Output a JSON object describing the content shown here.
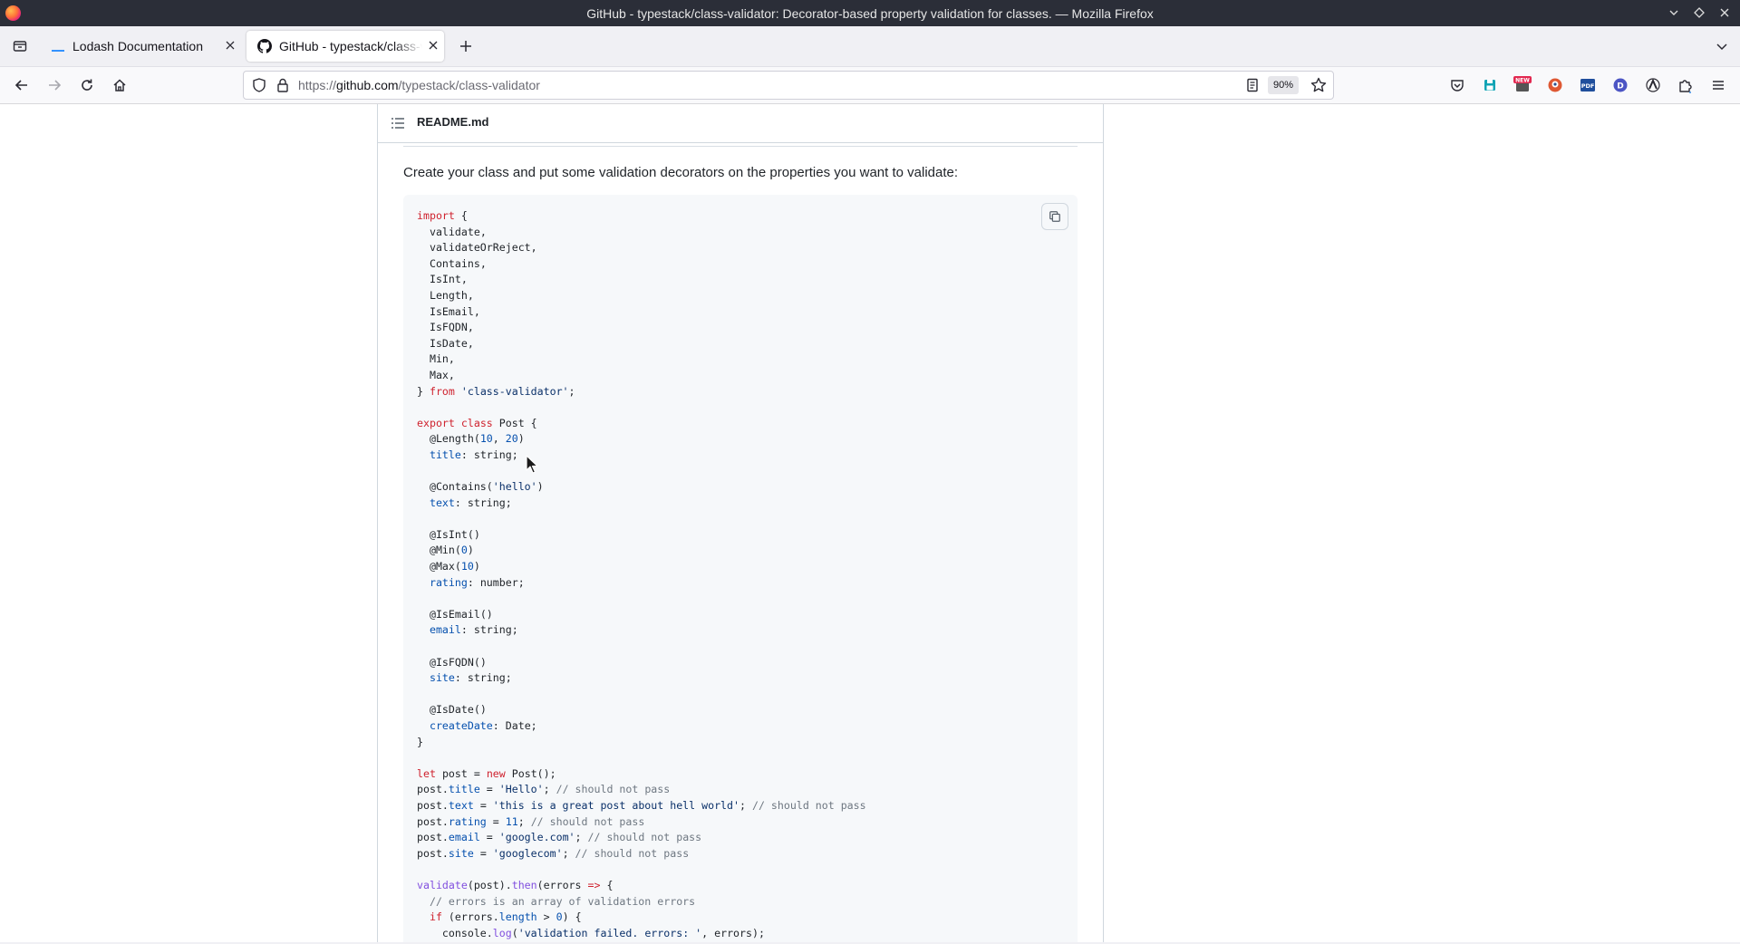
{
  "window": {
    "title": "GitHub - typestack/class-validator: Decorator-based property validation for classes. — Mozilla Firefox"
  },
  "tabs": [
    {
      "label": "Lodash Documentation",
      "active": false,
      "favicon": "lodash-favicon"
    },
    {
      "label": "GitHub - typestack/class-validator: Decorator-based property validation for classes.",
      "active": true,
      "favicon": "github-favicon"
    }
  ],
  "navbar": {
    "url_scheme": "https://",
    "url_host": "github.com",
    "url_path": "/typestack/class-validator",
    "zoom": "90%"
  },
  "readme": {
    "filename": "README.md",
    "intro": "Create your class and put some validation decorators on the properties you want to validate:"
  },
  "code_lines": [
    "import {",
    "  validate,",
    "  validateOrReject,",
    "  Contains,",
    "  IsInt,",
    "  Length,",
    "  IsEmail,",
    "  IsFQDN,",
    "  IsDate,",
    "  Min,",
    "  Max,",
    "} from 'class-validator';",
    "",
    "export class Post {",
    "  @Length(10, 20)",
    "  title: string;",
    "",
    "  @Contains('hello')",
    "  text: string;",
    "",
    "  @IsInt()",
    "  @Min(0)",
    "  @Max(10)",
    "  rating: number;",
    "",
    "  @IsEmail()",
    "  email: string;",
    "",
    "  @IsFQDN()",
    "  site: string;",
    "",
    "  @IsDate()",
    "  createDate: Date;",
    "}",
    "",
    "let post = new Post();",
    "post.title = 'Hello'; // should not pass",
    "post.text = 'this is a great post about hell world'; // should not pass",
    "post.rating = 11; // should not pass",
    "post.email = 'google.com'; // should not pass",
    "post.site = 'googlecom'; // should not pass",
    "",
    "validate(post).then(errors => {",
    "  // errors is an array of validation errors",
    "  if (errors.length > 0) {",
    "    console.log('validation failed. errors: ', errors);"
  ],
  "colors": {
    "keyword": "#cf222e",
    "string": "#0a3069",
    "number": "#0550ae",
    "function": "#8250df",
    "comment": "#6e7781",
    "titlebar": "#2b2e38"
  }
}
